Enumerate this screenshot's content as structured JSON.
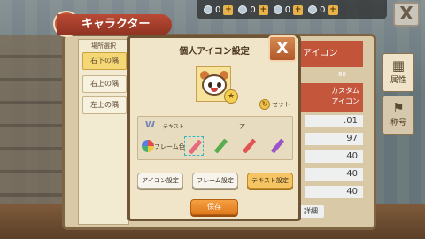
{
  "header": {
    "title": "キャラクター",
    "close_label": "X",
    "resources": [
      {
        "icon": "resource-icon",
        "value": "0"
      },
      {
        "icon": "resource-icon",
        "value": "0"
      },
      {
        "icon": "resource-icon",
        "value": "0"
      },
      {
        "icon": "resource-icon",
        "value": "0"
      }
    ]
  },
  "placement": {
    "title": "場所選択",
    "items": [
      {
        "label": "右下の隅",
        "active": true
      },
      {
        "label": "右上の隅",
        "active": false
      },
      {
        "label": "左上の隅",
        "active": false
      }
    ]
  },
  "dialog": {
    "title": "個人アイコン設定",
    "close_label": "X",
    "reset_label": "セット",
    "text_label": "テキスト",
    "text_sample": "ア",
    "frame_label": "フレーム色",
    "pencils": [
      {
        "color": "#e46c7e",
        "selected": true
      },
      {
        "color": "#5aad4f",
        "selected": false
      },
      {
        "color": "#e05454",
        "selected": false
      },
      {
        "color": "#9a54c9",
        "selected": false
      }
    ],
    "buttons": {
      "icon_setting": "アイコン設定",
      "frame_setting": "フレーム設定",
      "text_setting": "テキスト設定",
      "save": "保存"
    }
  },
  "background": {
    "tab_label": "アイコン",
    "stat_head": "80",
    "custom_label_1": "カスタム",
    "custom_label_2": "アイコン",
    "rows": [
      ".01",
      "97",
      "40",
      "40",
      "40"
    ],
    "detail": "詳細"
  },
  "side_tabs": [
    {
      "icon": "attribute-icon",
      "label": "属性"
    },
    {
      "icon": "title-icon",
      "label": "称号"
    }
  ],
  "colors": {
    "accent_red": "#c2543a",
    "dialog_bg": "#f0e5c8",
    "save_orange": "#e88a2a"
  }
}
